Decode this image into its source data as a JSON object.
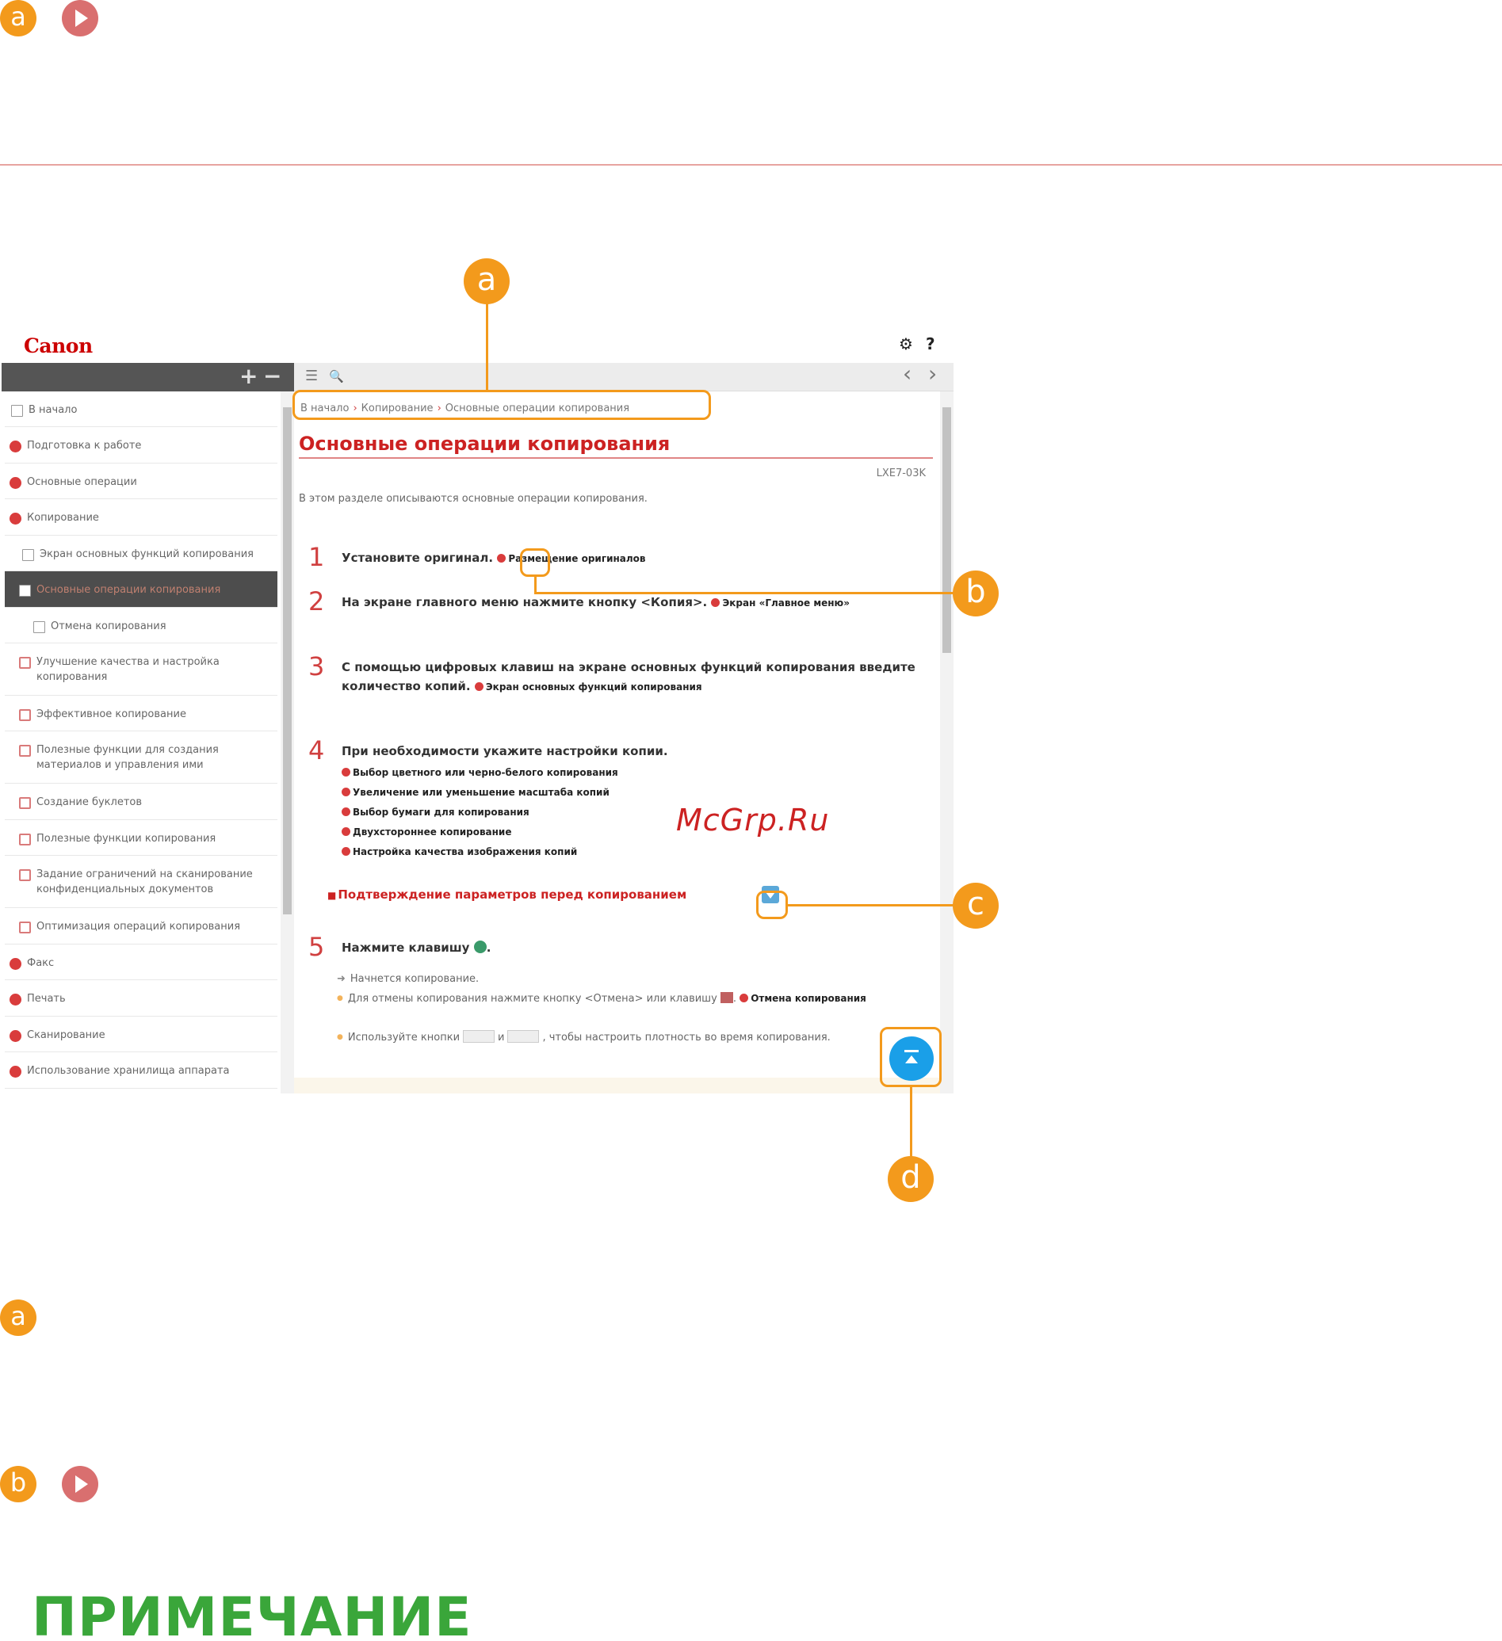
{
  "markers": {
    "a": "a",
    "b": "b",
    "c": "c",
    "d": "d"
  },
  "app": {
    "logo": "Canon",
    "settings_icon": "⚙",
    "help_icon": "?"
  },
  "sidebar": {
    "expand_all": "+",
    "collapse_all": "−",
    "items": [
      {
        "label": "В начало",
        "icon": "page"
      },
      {
        "label": "Подготовка к работе",
        "icon": "category"
      },
      {
        "label": "Основные операции",
        "icon": "category"
      },
      {
        "label": "Копирование",
        "icon": "category"
      },
      {
        "label": "Экран основных функций копирования",
        "icon": "page"
      },
      {
        "label": "Основные операции копирования",
        "icon": "page",
        "active": true
      },
      {
        "label": "Отмена копирования",
        "icon": "page"
      },
      {
        "label": "Улучшение качества и настройка копирования",
        "icon": "plus"
      },
      {
        "label": "Эффективное копирование",
        "icon": "plus"
      },
      {
        "label": "Полезные функции для создания материалов и управления ими",
        "icon": "plus"
      },
      {
        "label": "Создание буклетов",
        "icon": "plus"
      },
      {
        "label": "Полезные функции копирования",
        "icon": "plus"
      },
      {
        "label": "Задание ограничений на сканирование конфиденциальных документов",
        "icon": "plus"
      },
      {
        "label": "Оптимизация операций копирования",
        "icon": "plus"
      },
      {
        "label": "Факс",
        "icon": "category"
      },
      {
        "label": "Печать",
        "icon": "category"
      },
      {
        "label": "Сканирование",
        "icon": "category"
      },
      {
        "label": "Использование хранилища аппарата",
        "icon": "category"
      }
    ]
  },
  "toolbar": {
    "list_icon": "☰",
    "search_icon": "🔍",
    "prev": "‹",
    "next": "›"
  },
  "breadcrumb": [
    "В начало",
    "Копирование",
    "Основные операции копирования"
  ],
  "page": {
    "title": "Основные операции копирования",
    "code": "LXE7-03K",
    "intro": "В этом разделе описываются основные операции копирования."
  },
  "steps": [
    {
      "num": "1",
      "text": "Установите оригинал.",
      "link": "Размещение оригиналов"
    },
    {
      "num": "2",
      "text": "На экране главного меню нажмите кнопку <Копия>.",
      "link": "Экран «Главное меню»"
    },
    {
      "num": "3",
      "text": "С помощью цифровых клавиш на экране основных функций копирования введите количество копий.",
      "link": "Экран основных функций копирования"
    },
    {
      "num": "4",
      "text": "При необходимости укажите настройки копии."
    },
    {
      "num": "5",
      "text": "Нажмите клавишу"
    }
  ],
  "step4_links": [
    "Выбор цветного или черно-белого копирования",
    "Увеличение или уменьшение масштаба копий",
    "Выбор бумаги для копирования",
    "Двухстороннее копирование",
    "Настройка качества изображения копий"
  ],
  "confirm": "Подтверждение параметров перед копированием",
  "step5": {
    "result": "Начнется копирование.",
    "cancel_note": "Для отмены копирования нажмите кнопку <Отмена> или клавишу",
    "cancel_link": "Отмена копирования",
    "density_note_start": "Используйте кнопки",
    "density_and": "и",
    "density_note_end": ", чтобы настроить плотность во время копирования."
  },
  "watermark": "McGrp.Ru",
  "note_title": "ПРИМЕЧАНИЕ"
}
